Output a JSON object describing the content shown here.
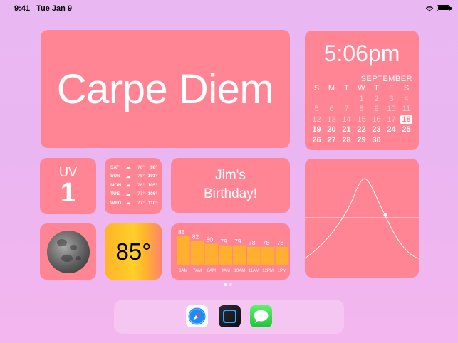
{
  "status": {
    "time": "9:41",
    "date": "Tue Jan 9"
  },
  "carpe": {
    "text": "Carpe Diem"
  },
  "calendar": {
    "time": "5:06pm",
    "month": "SEPTEMBER",
    "weekdays": [
      "S",
      "M",
      "T",
      "W",
      "T",
      "F",
      "S"
    ],
    "weeks": [
      [
        "",
        "",
        "",
        "1",
        "2",
        "3",
        "4"
      ],
      [
        "5",
        "6",
        "7",
        "8",
        "9",
        "10",
        "11"
      ],
      [
        "12",
        "13",
        "14",
        "15",
        "16",
        "17",
        "18"
      ],
      [
        "19",
        "20",
        "21",
        "22",
        "23",
        "24",
        "25"
      ],
      [
        "26",
        "27",
        "28",
        "29",
        "30",
        "",
        ""
      ]
    ],
    "today": "18"
  },
  "uv": {
    "label": "UV",
    "value": "1"
  },
  "forecast": [
    {
      "day": "SAT",
      "low": "76°",
      "high": "98°"
    },
    {
      "day": "SUN",
      "low": "76°",
      "high": "101°"
    },
    {
      "day": "MON",
      "low": "76°",
      "high": "105°"
    },
    {
      "day": "TUE",
      "low": "77°",
      "high": "106°"
    },
    {
      "day": "WED",
      "low": "77°",
      "high": "110°"
    }
  ],
  "birthday": {
    "line1": "Jim's",
    "line2": "Birthday!"
  },
  "temperature": {
    "value": "85°"
  },
  "hourly": {
    "categories": [
      "6AM",
      "7AM",
      "8AM",
      "9AM",
      "10AM",
      "11AM",
      "12PM",
      "1PM"
    ],
    "values": [
      85,
      82,
      80,
      79,
      79,
      78,
      78,
      78
    ]
  },
  "colors": {
    "widget": "#ff8594",
    "bar": "#ffb02e",
    "today_text": "#ff7e8c"
  },
  "dock": {
    "apps": [
      "safari-icon",
      "frame-app-icon",
      "messages-icon"
    ]
  }
}
